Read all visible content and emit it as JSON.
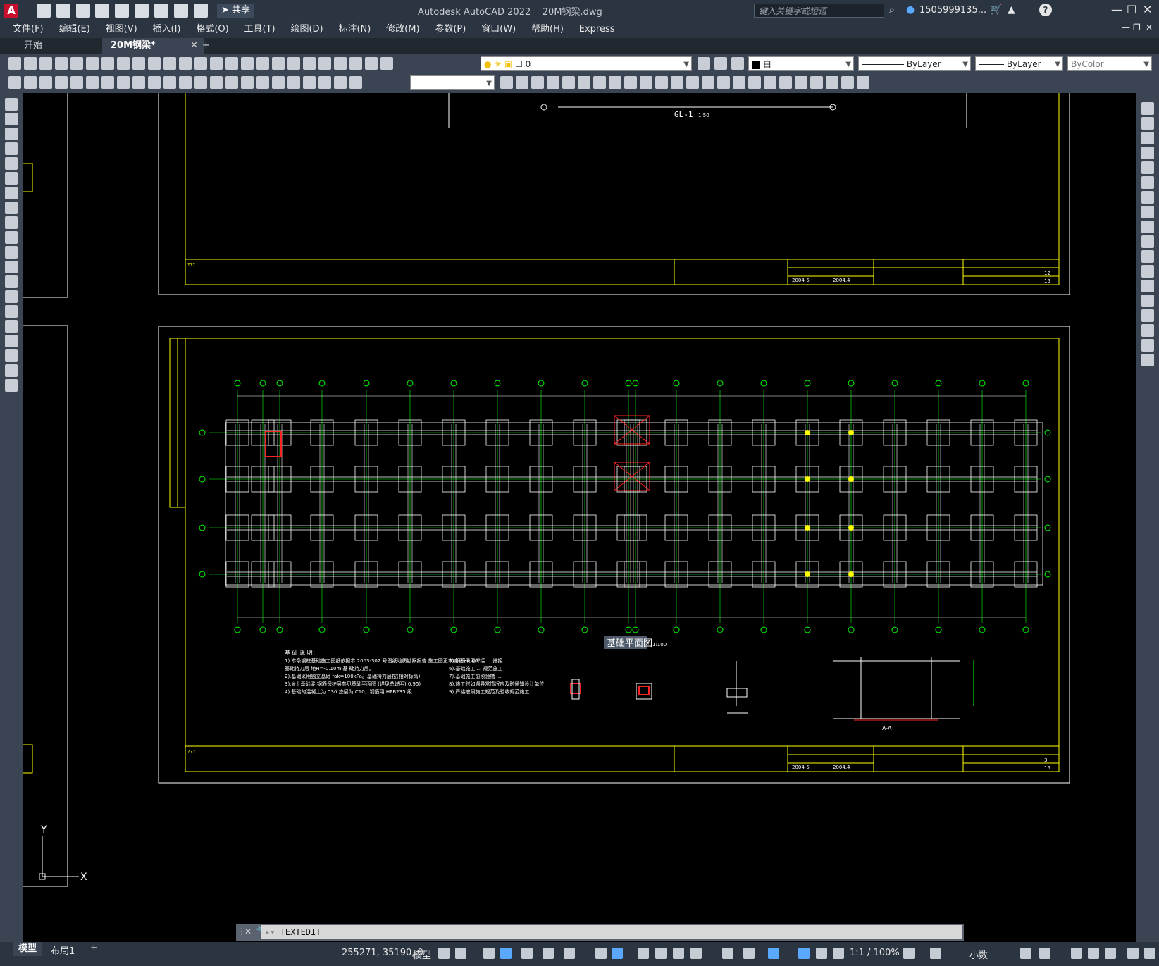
{
  "window": {
    "app_title": "Autodesk AutoCAD 2022",
    "file_title": "20M钢梁.dwg",
    "share_label": "共享",
    "search_placeholder": "键入关键字或短语",
    "user": "1505999135...",
    "help": "?"
  },
  "menu": [
    "文件(F)",
    "编辑(E)",
    "视图(V)",
    "插入(I)",
    "格式(O)",
    "工具(T)",
    "绘图(D)",
    "标注(N)",
    "修改(M)",
    "参数(P)",
    "窗口(W)",
    "帮助(H)",
    "Express"
  ],
  "tabs": {
    "start": "开始",
    "active": "20M钢梁*",
    "add": "+"
  },
  "layer": {
    "name": "0"
  },
  "properties": {
    "color": "白",
    "linetype": "ByLayer",
    "lineweight": "ByLayer",
    "plotstyle": "ByColor"
  },
  "drawing": {
    "sheet_top": {
      "scale_label": "GL-1",
      "scale_note": "1:50",
      "sheet_no": "12",
      "sheet_total": "15",
      "date1": "2004-5",
      "date2": "2004.4",
      "title_mark": "???"
    },
    "sheet_main": {
      "plan_title": "基础平面图",
      "plan_scale": "1:100",
      "sheet_no": "3",
      "sheet_total": "15",
      "date1": "2004-5",
      "date2": "2004.4",
      "title_mark": "???",
      "section_label": "A-A",
      "notes_heading": "基 础 说 明："
    },
    "notes_left": [
      "1).本条钢柱基础施工图纸依据本 2003-302 号图纸地质勘察报告 施工图正本编号±0.00",
      "基础持力层 地H=-0.10m 基 础持力层。",
      "2).基础采用独立基础 fak=100kPa。基础持力层按(相对标高)",
      "3).⑧上基础梁 钢筋保护层参见基础平面图 (详见总说明) 0.95)",
      "4).基础的混凝土为 C30 垫层为 C10，钢筋用 HPB235 级"
    ],
    "notes_right": [
      "5).钢筋采用焊接 ... 搭接",
      "6).基础施工 ... 规范施工",
      "7).基础施工前须验槽 ...",
      "8).施工时如遇异常情况应及时通知设计单位",
      "9).严格按照施工规范及验收规范施工"
    ],
    "ucs": {
      "x": "X",
      "y": "Y"
    }
  },
  "cmdline": {
    "text": "TEXTEDIT"
  },
  "status": {
    "tab_model": "模型",
    "tab_layout": "布局1",
    "add": "+",
    "coords": "255271, 35190, 0",
    "mode": "模型",
    "scale": "1:1 / 100%",
    "units": "小数"
  },
  "colors": {
    "frame": "#ffffff",
    "title_block": "#ffff00",
    "axis": "#00ff00",
    "highlight": "#ff2020",
    "node": "#ffff00",
    "ui_dark": "#2b3441"
  }
}
